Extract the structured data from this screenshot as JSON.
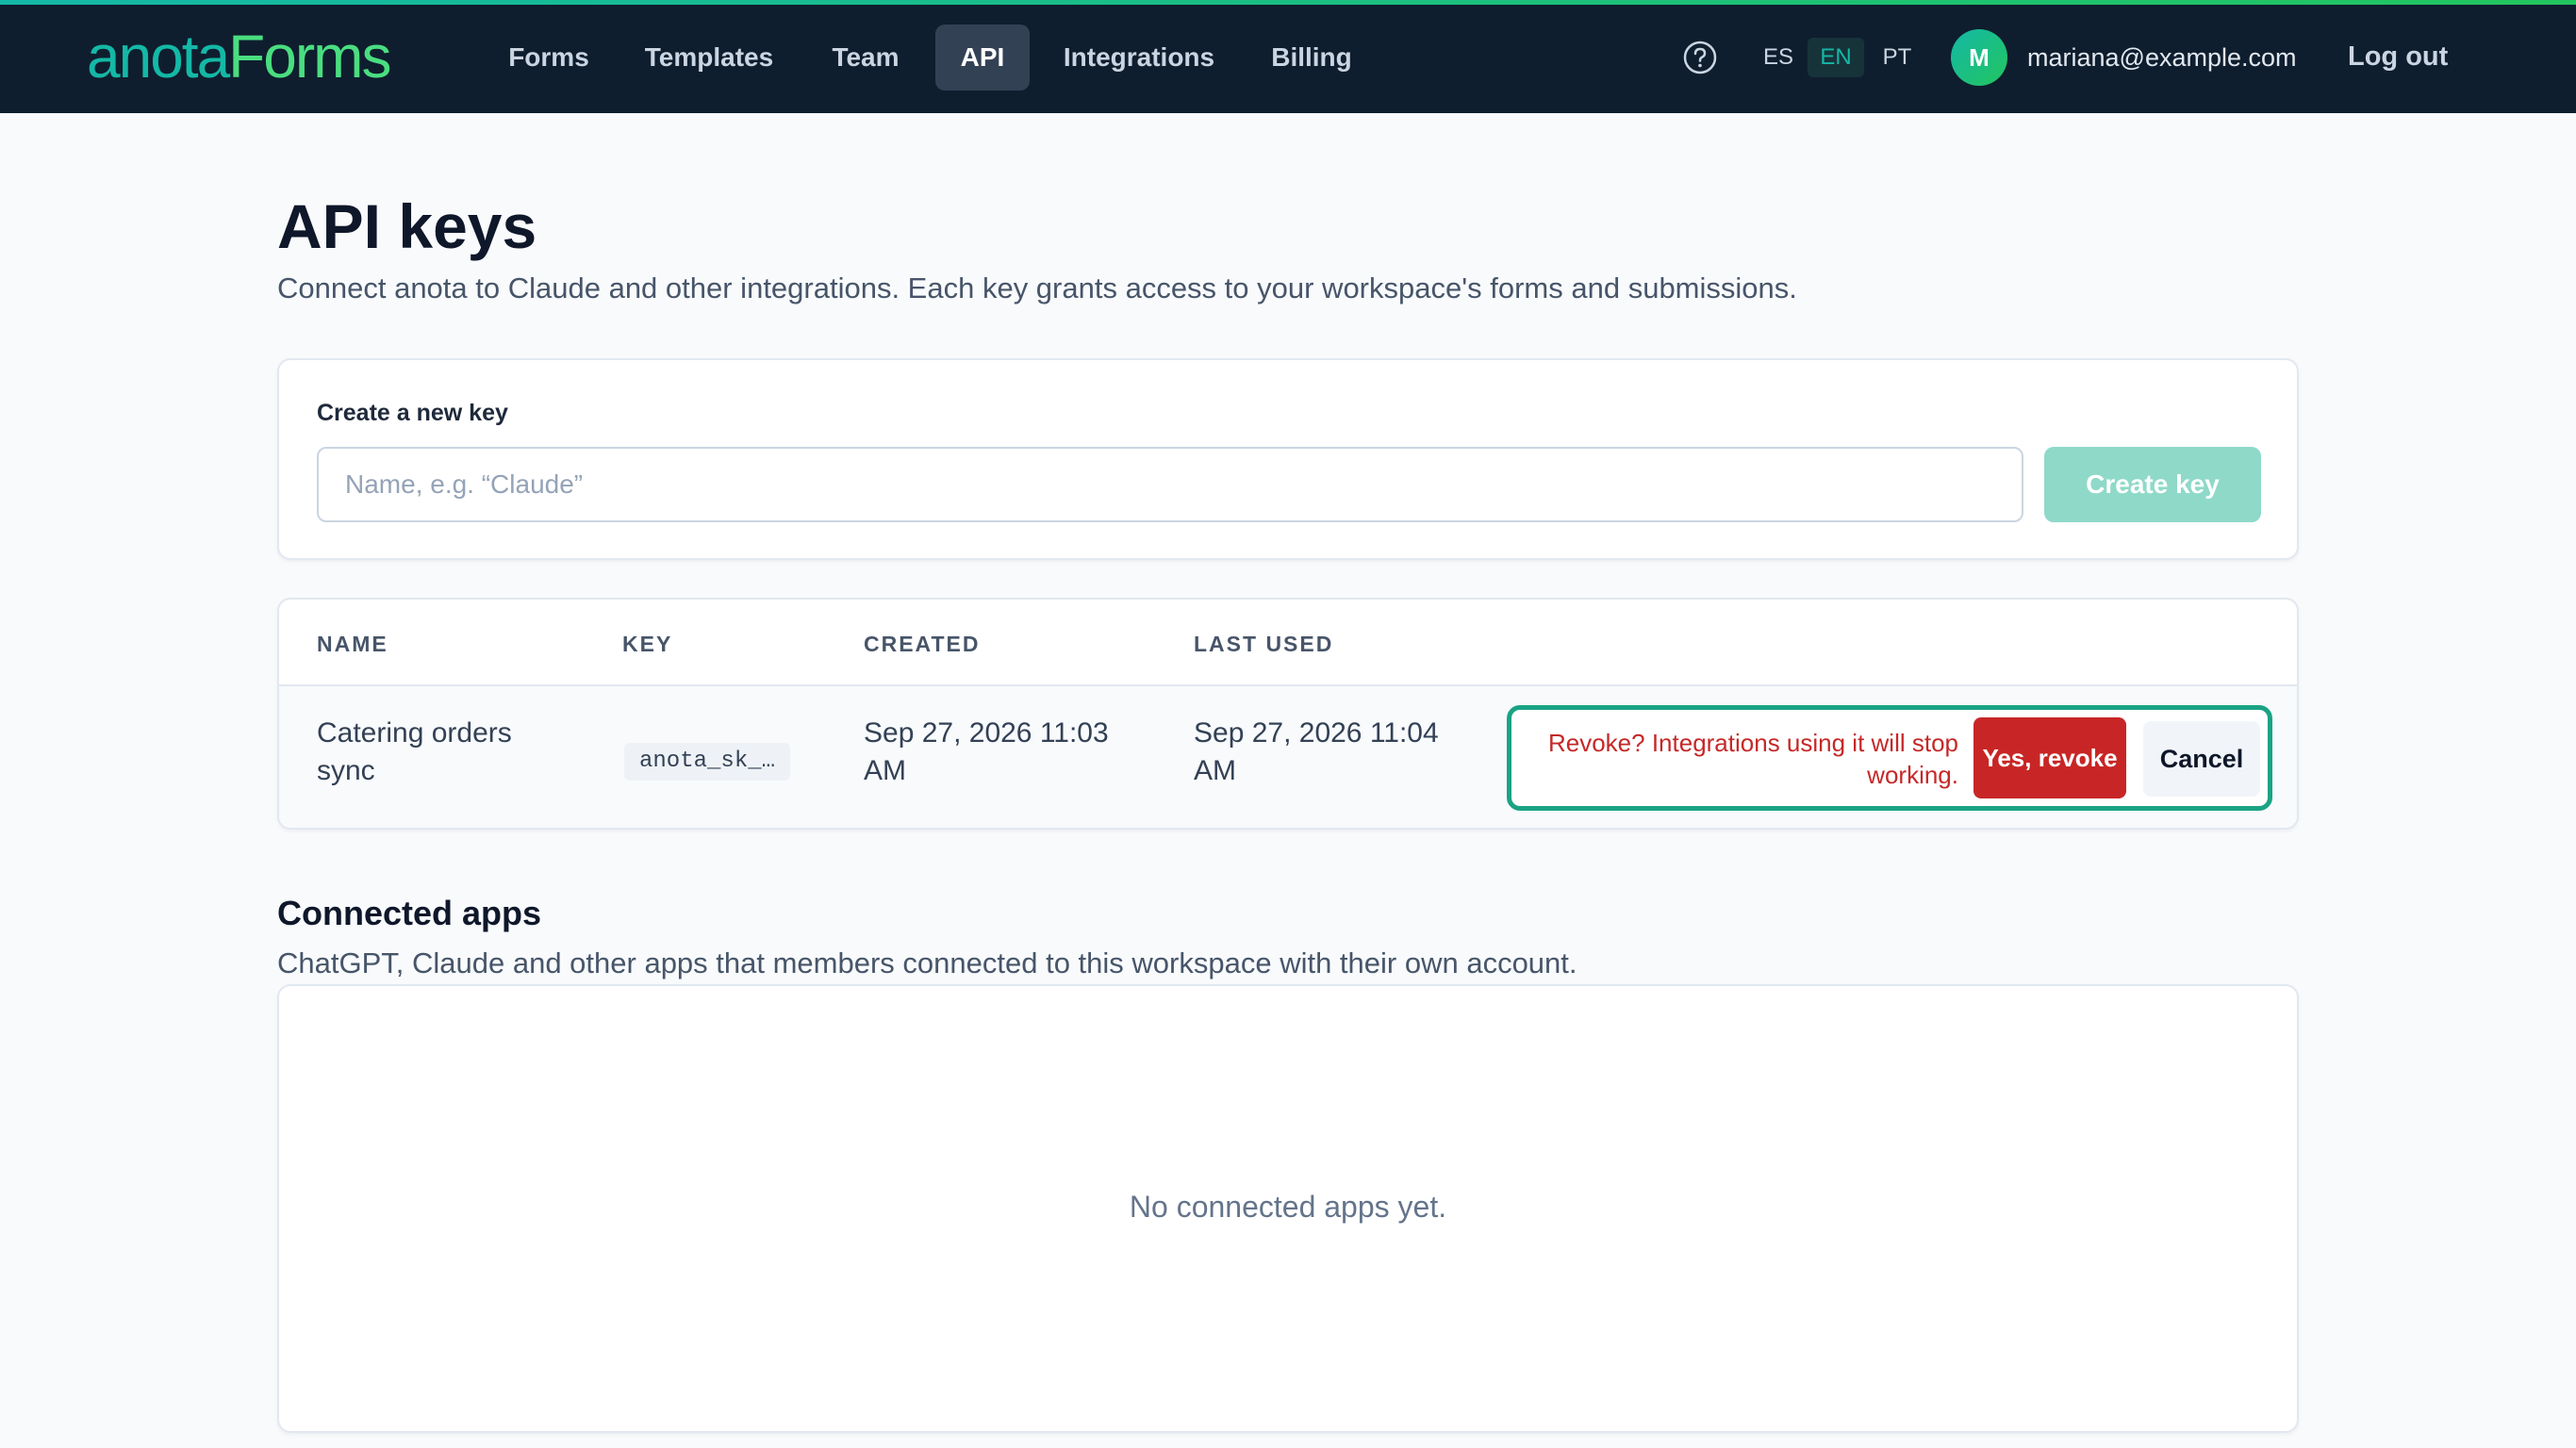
{
  "nav": {
    "logo_part1": "anota",
    "logo_part2": "Forms",
    "items": [
      {
        "label": "Forms"
      },
      {
        "label": "Templates"
      },
      {
        "label": "Team"
      },
      {
        "label": "API",
        "active": true
      },
      {
        "label": "Integrations"
      },
      {
        "label": "Billing"
      }
    ],
    "help_icon": "question-circle-icon",
    "languages": [
      {
        "code": "ES"
      },
      {
        "code": "EN",
        "active": true
      },
      {
        "code": "PT"
      }
    ],
    "avatar_initial": "M",
    "user_email": "mariana@example.com",
    "logout_label": "Log out"
  },
  "page": {
    "title": "API keys",
    "subtitle": "Connect anota to Claude and other integrations. Each key grants access to your workspace's forms and submissions."
  },
  "create": {
    "label": "Create a new key",
    "placeholder": "Name, e.g. “Claude”",
    "value": "",
    "button": "Create key"
  },
  "keys_table": {
    "headers": [
      "NAME",
      "KEY",
      "CREATED",
      "LAST USED"
    ],
    "rows": [
      {
        "name": "Catering orders sync",
        "key": "anota_sk_…",
        "created": "Sep 27, 2026 11:03 AM",
        "last_used": "Sep 27, 2026 11:04 AM",
        "confirm": {
          "text": "Revoke? Integrations using it will stop working.",
          "yes": "Yes, revoke",
          "cancel": "Cancel"
        }
      }
    ]
  },
  "connected": {
    "title": "Connected apps",
    "subtitle": "ChatGPT, Claude and other apps that members connected to this workspace with their own account.",
    "empty": "No connected apps yet."
  },
  "colors": {
    "nav_bg": "#0f1e2e",
    "accent": "#14b8a6",
    "danger": "#c82626",
    "confirm_border": "#1aa384"
  }
}
